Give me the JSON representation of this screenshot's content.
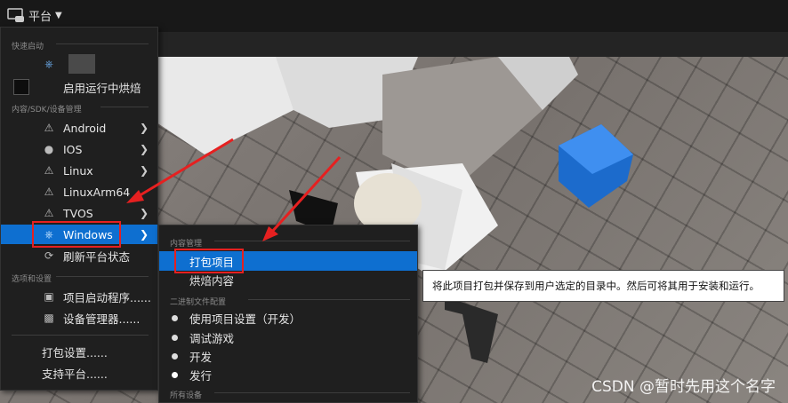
{
  "topbar": {
    "platform_label": "平台"
  },
  "menu": {
    "section_quick": "快速启动",
    "bake_toggle_label": "启用运行中烘焙",
    "section_content": "内容/SDK/设备管理",
    "platforms": [
      {
        "label": "Android",
        "icon": "warning-icon"
      },
      {
        "label": "IOS",
        "icon": "apple-icon"
      },
      {
        "label": "Linux",
        "icon": "warning-icon"
      },
      {
        "label": "LinuxArm64",
        "icon": "warning-icon"
      },
      {
        "label": "TVOS",
        "icon": "warning-icon"
      },
      {
        "label": "Windows",
        "icon": "unreal-icon"
      }
    ],
    "refresh_label": "刷新平台状态",
    "section_options": "选项和设置",
    "project_launcher": "项目启动程序......",
    "device_manager": "设备管理器......",
    "packaging_settings": "打包设置......",
    "supported_platforms": "支持平台......"
  },
  "submenu": {
    "section_content": "内容管理",
    "package_project": "打包项目",
    "cook_content": "烘焙内容",
    "section_binary": "二进制文件配置",
    "configs": [
      {
        "label": "使用项目设置（开发）"
      },
      {
        "label": "调试游戏"
      },
      {
        "label": "开发"
      },
      {
        "label": "发行"
      }
    ],
    "section_devices": "所有设备"
  },
  "tooltip": {
    "text": "将此项目打包并保存到用户选定的目录中。然后可将其用于安装和运行。"
  },
  "watermark": "CSDN @暂时先用这个名字",
  "colors": {
    "highlight": "#0e6fd0",
    "annotation": "#e62020",
    "menu_bg": "#1f1f1f"
  }
}
